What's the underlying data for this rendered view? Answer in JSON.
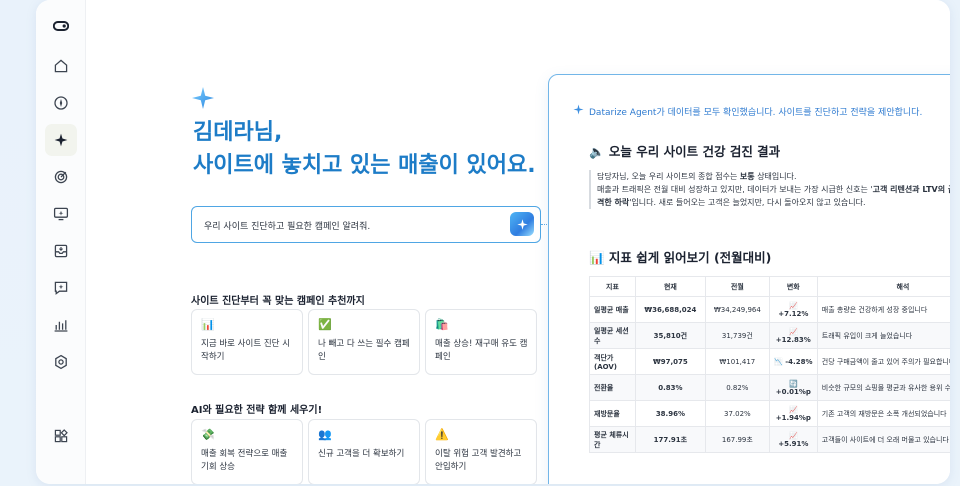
{
  "sidebar": {
    "items": [
      {
        "icon": "toggle-icon"
      },
      {
        "icon": "home-icon"
      },
      {
        "icon": "compass-icon"
      },
      {
        "icon": "sparkle-icon"
      },
      {
        "icon": "target-icon"
      },
      {
        "icon": "monitor-icon"
      },
      {
        "icon": "inbox-icon"
      },
      {
        "icon": "chat-sparkle-icon"
      },
      {
        "icon": "bar-chart-icon"
      },
      {
        "icon": "settings-icon"
      },
      {
        "icon": "apps-icon"
      }
    ]
  },
  "hero": {
    "line1": "김데라님,",
    "line2": "사이트에 놓치고 있는 매출이 있어요."
  },
  "prompt": {
    "value": "우리 사이트 진단하고 필요한 캠페인 알려줘."
  },
  "section1": {
    "title": "사이트 진단부터 꼭 맞는 캠페인 추천까지",
    "cards": [
      {
        "emoji": "📊",
        "text": "지금 바로 사이트 진단 시작하기"
      },
      {
        "emoji": "✅",
        "text": "나 빼고 다 쓰는 필수 캠페인"
      },
      {
        "emoji": "🛍️",
        "text": "매출 상승! 재구매 유도 캠페인"
      }
    ]
  },
  "section2": {
    "title": "AI와 필요한 전략 함께 세우기!",
    "cards": [
      {
        "emoji": "💸",
        "text": "매출 회복 전략으로 매출 기회 상승"
      },
      {
        "emoji": "👥",
        "text": "신규 고객을 더 확보하기"
      },
      {
        "emoji": "⚠️",
        "text": "이탈 위험 고객 발견하고 안입하기"
      }
    ]
  },
  "panel": {
    "agent_line": "Datarize Agent가 데이터를 모두 확인했습니다. 사이트를 진단하고 전략을 제안합니다.",
    "health_title": "🔈 오늘 우리 사이트 건강 검진 결과",
    "quote_l1a": "담당자님, 오늘 우리 사이트의 종합 점수는 ",
    "quote_l1b": "보통",
    "quote_l1c": " 상태입니다.",
    "quote_l2a": "매출과 트래픽은 전월 대비 성장하고 있지만, 데이터가 보내는 가장 시급한 신호는 '",
    "quote_l2b": "고객 리텐션과 LTV의 급격한 하락",
    "quote_l2c": "'입니다. 새로 들어오는 고객은 늘었지만, 다시 돌아오지 않고 있습니다.",
    "metrics_title": "📊 지표 쉽게 읽어보기 (전월대비)",
    "table": {
      "headers": [
        "지표",
        "현재",
        "전월",
        "변화",
        "해석"
      ],
      "rows": [
        {
          "metric": "일평균 매출",
          "current": "₩36,688,024",
          "prev": "₩34,249,964",
          "change": "📈 +7.12%",
          "note": "매출 총량은 건강하게 성장 중입니다"
        },
        {
          "metric": "일평균 세션 수",
          "current": "35,810건",
          "prev": "31,739건",
          "change": "📈 +12.83%",
          "note": "트래픽 유입이 크게 늘었습니다"
        },
        {
          "metric": "객단가 (AOV)",
          "current": "₩97,075",
          "prev": "₩101,417",
          "change": "📉 -4.28%",
          "note": "건당 구매금액이 줄고 있어 주의가 필요합니다"
        },
        {
          "metric": "전환율",
          "current": "0.83%",
          "prev": "0.82%",
          "change": "🔄 +0.01%p",
          "note": "비슷한 규모의 쇼핑몰 평균과 유사한 용위 수준이에요"
        },
        {
          "metric": "재방문율",
          "current": "38.96%",
          "prev": "37.02%",
          "change": "📈 +1.94%p",
          "note": "기존 고객의 재방문은 소폭 개선되었습니다"
        },
        {
          "metric": "평균 체류시간",
          "current": "177.91초",
          "prev": "167.99초",
          "change": "📈 +5.91%",
          "note": "고객들이 사이트에 더 오래 머물고 있습니다"
        }
      ]
    }
  }
}
